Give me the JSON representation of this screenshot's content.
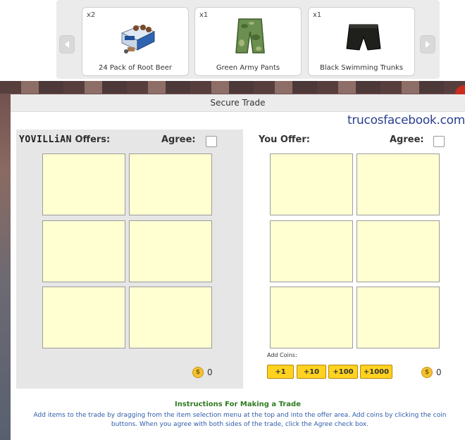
{
  "selector": {
    "items": [
      {
        "qty": "x2",
        "name": "24 Pack of Root Beer",
        "icon": "root-beer-pack-icon"
      },
      {
        "qty": "x1",
        "name": "Green Army Pants",
        "icon": "army-pants-icon"
      },
      {
        "qty": "x1",
        "name": "Black Swimming Trunks",
        "icon": "swim-trunks-icon"
      }
    ]
  },
  "window": {
    "title": "Secure Trade",
    "watermark": "trucosfacebook.com"
  },
  "them": {
    "brand": "YOVILLiAN",
    "offers_label": "Offers:",
    "agree_label": "Agree:",
    "coins": "0"
  },
  "you": {
    "offer_label": "You Offer:",
    "agree_label": "Agree:",
    "coins": "0"
  },
  "add_coins": {
    "label": "Add Coins:",
    "buttons": [
      "+1",
      "+10",
      "+100",
      "+1000"
    ]
  },
  "coin_symbol": "$",
  "instructions": {
    "title": "Instructions For Making a Trade",
    "body": "Add items to the trade by dragging from the item selection menu at the top and into the offer area. Add coins by clicking the coin buttons. When you agree with both sides of the trade, click the Agree check box."
  },
  "colors": {
    "slot_fill": "#ffffd2",
    "coin_button": "#ffd21f",
    "instruction_title": "#2e7b1f",
    "instruction_body": "#2d5cab",
    "watermark": "#2a3f8f"
  }
}
